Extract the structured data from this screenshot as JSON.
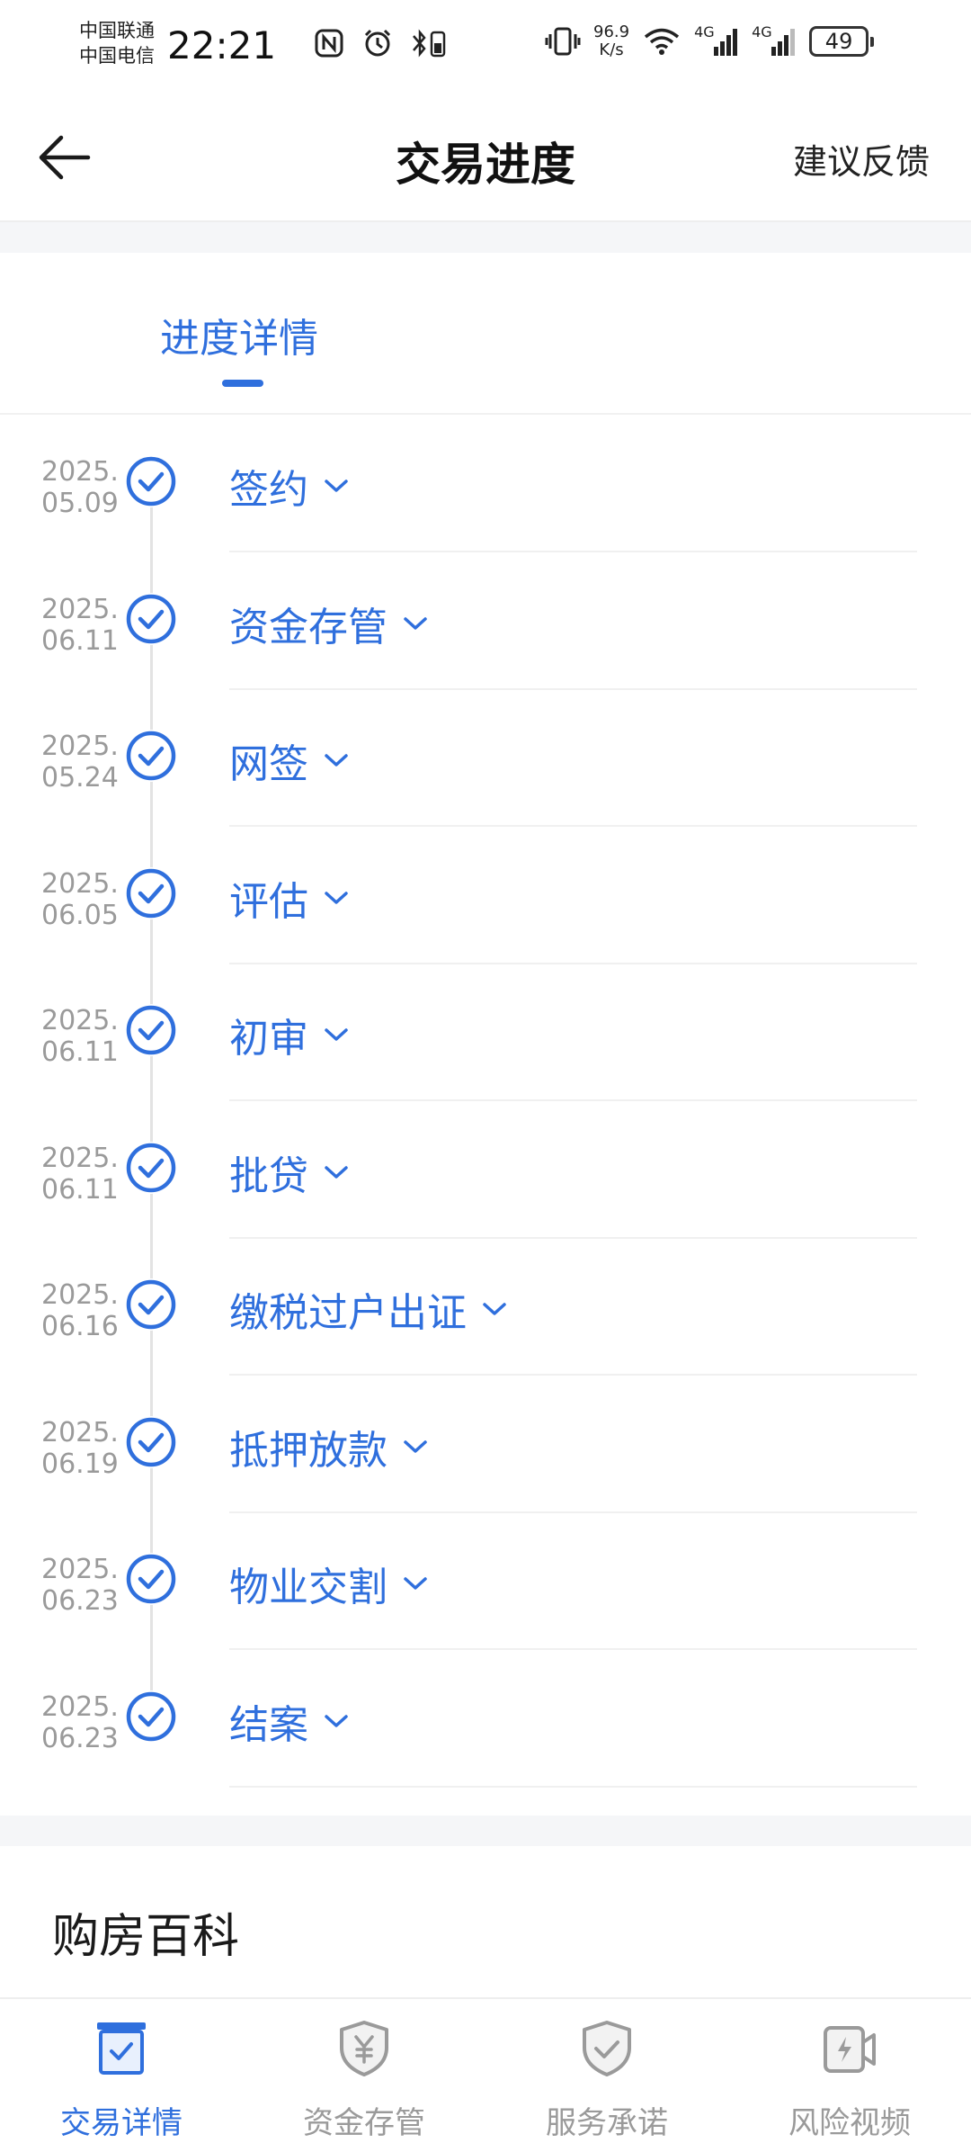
{
  "status_bar": {
    "carrier1": "中国联通",
    "carrier2": "中国电信",
    "time": "22:21",
    "net_speed_value": "96.9",
    "net_speed_unit": "K/s",
    "signal1": "4G",
    "signal2": "4G",
    "battery": "49"
  },
  "header": {
    "title": "交易进度",
    "feedback": "建议反馈"
  },
  "tab": {
    "label": "进度详情"
  },
  "steps": [
    {
      "date_year": "2025.",
      "date_day": "05.09",
      "title": "签约"
    },
    {
      "date_year": "2025.",
      "date_day": "06.11",
      "title": "资金存管"
    },
    {
      "date_year": "2025.",
      "date_day": "05.24",
      "title": "网签"
    },
    {
      "date_year": "2025.",
      "date_day": "06.05",
      "title": "评估"
    },
    {
      "date_year": "2025.",
      "date_day": "06.11",
      "title": "初审"
    },
    {
      "date_year": "2025.",
      "date_day": "06.11",
      "title": "批贷"
    },
    {
      "date_year": "2025.",
      "date_day": "06.16",
      "title": "缴税过户出证"
    },
    {
      "date_year": "2025.",
      "date_day": "06.19",
      "title": "抵押放款"
    },
    {
      "date_year": "2025.",
      "date_day": "06.23",
      "title": "物业交割"
    },
    {
      "date_year": "2025.",
      "date_day": "06.23",
      "title": "结案"
    }
  ],
  "encyclopedia": {
    "title": "购房百科"
  },
  "bottom_nav": [
    {
      "label": "交易详情",
      "icon": "transaction-detail-icon",
      "active": true
    },
    {
      "label": "资金存管",
      "icon": "yuan-shield-icon",
      "active": false
    },
    {
      "label": "服务承诺",
      "icon": "check-shield-icon",
      "active": false
    },
    {
      "label": "风险视频",
      "icon": "video-icon",
      "active": false
    }
  ],
  "colors": {
    "accent": "#2f6fdd",
    "muted": "#9a9a9a",
    "divider": "#f0f0f0"
  }
}
